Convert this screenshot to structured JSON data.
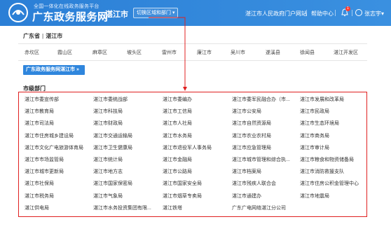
{
  "header": {
    "logo_subtitle": "全国一体化在线政务服务平台",
    "logo_title": "广东政务服务网",
    "city": "湛江市",
    "switch_label": "切换区域和部门",
    "links": [
      "湛江市人民政府门户网站",
      "帮助中心"
    ],
    "notification_count": "1",
    "user_name": "张志宇"
  },
  "breadcrumb": {
    "province": "广东省",
    "city": "湛江市",
    "separator": "|"
  },
  "districts": [
    "赤坎区",
    "霞山区",
    "麻章区",
    "坡头区",
    "雷州市",
    "廉江市",
    "吴川市",
    "遂溪县",
    "徐闻县",
    "湛江开发区"
  ],
  "banner_button": {
    "label": "广东政务服务网湛江市",
    "icon": "double-chevron-right-icon"
  },
  "section": {
    "title": "市级部门"
  },
  "departments": [
    [
      "湛江市委宣传部",
      "湛江市委统战部",
      "湛江市委编办",
      "湛江市委军民融合办（市...",
      "湛江市发展和改革局"
    ],
    [
      "湛江市教育局",
      "湛江市科技局",
      "湛江市工信局",
      "湛江市公安局",
      "湛江市民政局"
    ],
    [
      "湛江市司法局",
      "湛江市财政局",
      "湛江市人社局",
      "湛江市自然资源局",
      "湛江市生态环境局"
    ],
    [
      "湛江市住房城乡建设局",
      "湛江市交通运输局",
      "湛江市水务局",
      "湛江市农业农村局",
      "湛江市商务局"
    ],
    [
      "湛江市文化广电旅游体育局",
      "湛江市卫生健康局",
      "湛江市退役军人事务局",
      "湛江市应急管理局",
      "湛江市审计局"
    ],
    [
      "湛江市市场监管局",
      "湛江市统计局",
      "湛江市金融局",
      "湛江市城市管理和综合执...",
      "湛江市粮食和物资储备局"
    ],
    [
      "湛江市城市更新局",
      "湛江市地方志",
      "湛江市公路局",
      "湛江市档案局",
      "湛江市消防救援支队"
    ],
    [
      "湛江市社保局",
      "湛江市国家保密局",
      "湛江市国家安全局",
      "湛江市残疾人联合会",
      "湛江市住房公积金管理中心"
    ],
    [
      "湛江市税务局",
      "湛江市气象局",
      "湛江市烟草专卖局",
      "湛江市通建办",
      "湛江市地震局"
    ],
    [
      "湛江供电局",
      "湛江市水务投资集团有限...",
      "湛江铁塔",
      "广东广电网络湛江分公司",
      ""
    ]
  ],
  "colors": {
    "header_blue": "#2b7fd6",
    "accent_blue": "#2f86dd",
    "annotation_red": "#e02020"
  }
}
